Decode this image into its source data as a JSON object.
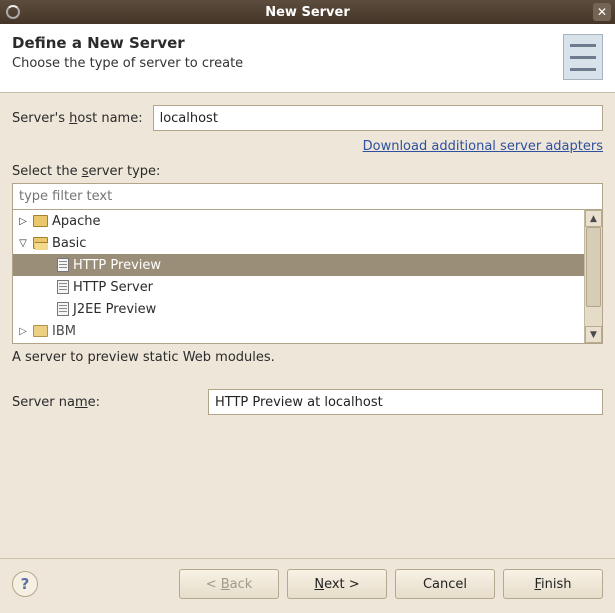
{
  "window": {
    "title": "New Server"
  },
  "header": {
    "title": "Define a New Server",
    "subtitle": "Choose the type of server to create"
  },
  "hostname": {
    "label_pre": "Server's ",
    "label_u": "h",
    "label_post": "ost name:",
    "value": "localhost"
  },
  "download_link": "Download additional server adapters",
  "server_type": {
    "label_pre": "Select the ",
    "label_u": "s",
    "label_post": "erver type:",
    "filter_placeholder": "type filter text"
  },
  "tree": [
    {
      "kind": "folder",
      "expanded": false,
      "label": "Apache"
    },
    {
      "kind": "folder",
      "expanded": true,
      "label": "Basic",
      "children": [
        {
          "label": "HTTP Preview",
          "selected": true
        },
        {
          "label": "HTTP Server",
          "selected": false
        },
        {
          "label": "J2EE Preview",
          "selected": false
        }
      ]
    },
    {
      "kind": "folder",
      "expanded": false,
      "label": "IBM"
    }
  ],
  "description": "A server to preview static Web modules.",
  "server_name": {
    "label_pre": "Server na",
    "label_u": "m",
    "label_post": "e:",
    "value": "HTTP Preview at localhost"
  },
  "buttons": {
    "back_pre": "< ",
    "back_u": "B",
    "back_post": "ack",
    "next_u": "N",
    "next_post": "ext >",
    "cancel": "Cancel",
    "finish_u": "F",
    "finish_post": "inish"
  }
}
